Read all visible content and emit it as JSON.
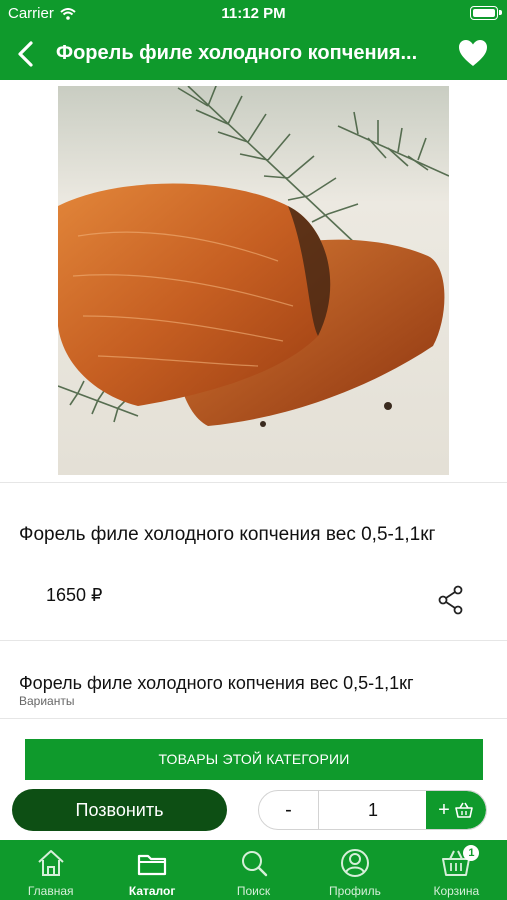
{
  "status_bar": {
    "carrier": "Carrier",
    "time": "11:12 PM"
  },
  "header": {
    "title": "Форель филе холодного копчения..."
  },
  "product": {
    "title": "Форель филе холодного копчения вес 0,5-1,1кг",
    "price": "1650 ₽",
    "variant_name": "Форель филе холодного копчения вес 0,5-1,1кг",
    "variant_label": "Варианты"
  },
  "category_button": "ТОВАРЫ ЭТОЙ КАТЕГОРИИ",
  "actions": {
    "call_label": "Позвонить",
    "minus_label": "-",
    "quantity": "1",
    "plus_label": "+"
  },
  "tabs": [
    {
      "label": "Главная",
      "icon": "home-icon"
    },
    {
      "label": "Каталог",
      "icon": "folder-icon",
      "active": true
    },
    {
      "label": "Поиск",
      "icon": "search-icon"
    },
    {
      "label": "Профиль",
      "icon": "profile-icon"
    },
    {
      "label": "Корзина",
      "icon": "basket-icon",
      "badge": "1"
    }
  ],
  "colors": {
    "brand_green": "#0f9a2c",
    "dark_green": "#0d4f14"
  }
}
